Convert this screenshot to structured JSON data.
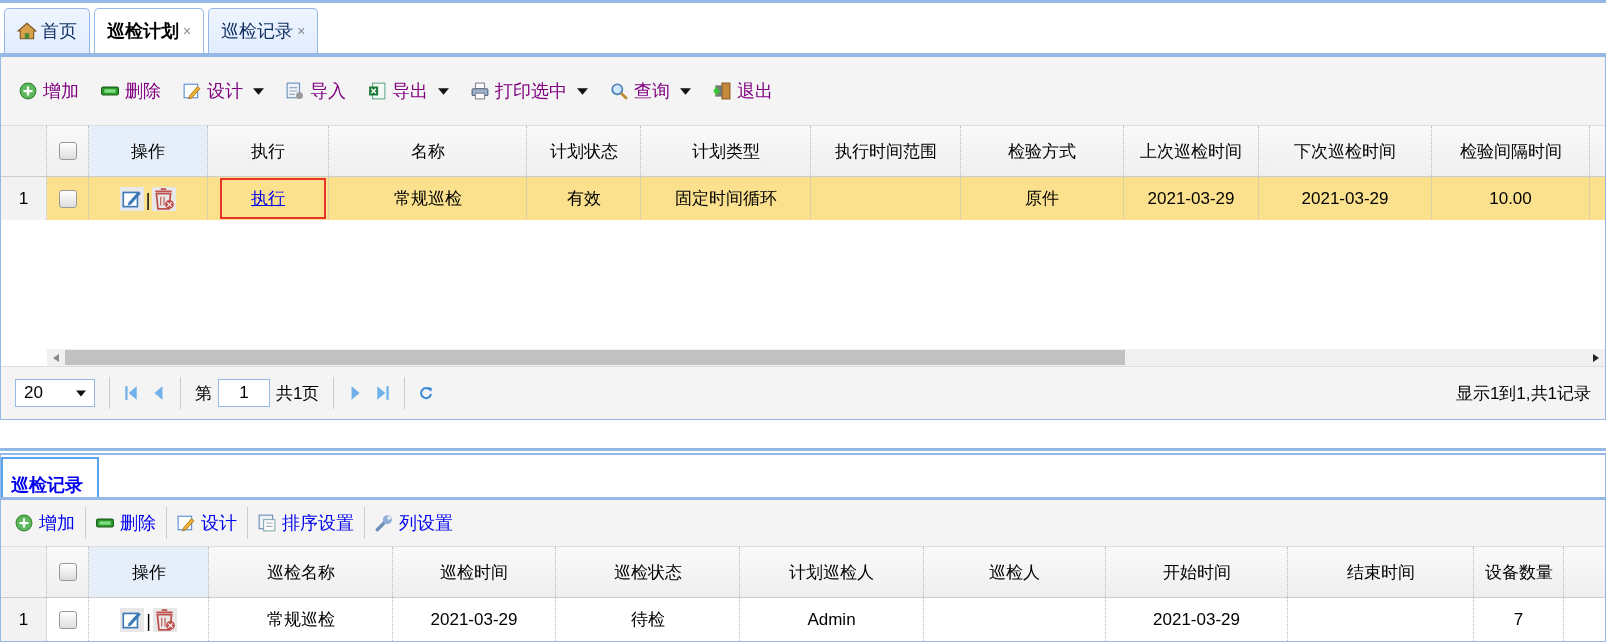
{
  "tabs": [
    {
      "label": "首页",
      "closable": false,
      "selected": false
    },
    {
      "label": "巡检计划",
      "closable": true,
      "selected": true
    },
    {
      "label": "巡检记录",
      "closable": true,
      "selected": false
    }
  ],
  "close_glyph": "×",
  "action_separator": "|",
  "plan_panel": {
    "toolbar": [
      {
        "kind": "add",
        "label": "增加",
        "dropdown": false
      },
      {
        "kind": "delete",
        "label": "删除",
        "dropdown": false
      },
      {
        "kind": "design",
        "label": "设计",
        "dropdown": true
      },
      {
        "kind": "import",
        "label": "导入",
        "dropdown": false
      },
      {
        "kind": "export",
        "label": "导出",
        "dropdown": true
      },
      {
        "kind": "print",
        "label": "打印选中",
        "dropdown": true
      },
      {
        "kind": "search",
        "label": "查询",
        "dropdown": true
      },
      {
        "kind": "exit",
        "label": "退出",
        "dropdown": false
      }
    ],
    "table": {
      "all_checked": false,
      "columns": [
        "操作",
        "执行",
        "名称",
        "计划状态",
        "计划类型",
        "执行时间范围",
        "检验方式",
        "上次巡检时间",
        "下次巡检时间",
        "检验间隔时间"
      ],
      "rows": [
        {
          "number": "1",
          "checked": false,
          "selected": true,
          "cells": [
            {
              "kind": "actions"
            },
            {
              "kind": "link",
              "text": "执行",
              "marked": true
            },
            {
              "kind": "text",
              "text": "常规巡检"
            },
            {
              "kind": "text",
              "text": "有效"
            },
            {
              "kind": "text",
              "text": "固定时间循环"
            },
            {
              "kind": "blank"
            },
            {
              "kind": "text",
              "text": "原件"
            },
            {
              "kind": "text",
              "text": "2021-03-29"
            },
            {
              "kind": "text",
              "text": "2021-03-29"
            },
            {
              "kind": "text",
              "text": "10.00"
            }
          ]
        }
      ]
    },
    "pager": {
      "page_size": "20",
      "page_label": "第",
      "page": "1",
      "page_total": "共1页",
      "summary": "显示1到1,共1记录"
    }
  },
  "record_panel": {
    "tab": {
      "label": "巡检记录",
      "selected": true
    },
    "toolbar": [
      {
        "kind": "add",
        "label": "增加",
        "dropdown": false
      },
      {
        "kind": "delete",
        "label": "删除",
        "dropdown": false
      },
      {
        "kind": "design",
        "label": "设计",
        "dropdown": false
      },
      {
        "kind": "sort",
        "label": "排序设置",
        "dropdown": false
      },
      {
        "kind": "columns",
        "label": "列设置",
        "dropdown": false
      }
    ],
    "table": {
      "all_checked": false,
      "columns": [
        "操作",
        "巡检名称",
        "巡检时间",
        "巡检状态",
        "计划巡检人",
        "巡检人",
        "开始时间",
        "结束时间",
        "设备数量"
      ],
      "rows": [
        {
          "number": "1",
          "checked": false,
          "selected": false,
          "cells": [
            {
              "kind": "actions"
            },
            {
              "kind": "text",
              "text": "常规巡检"
            },
            {
              "kind": "text",
              "text": "2021-03-29"
            },
            {
              "kind": "text",
              "text": "待检"
            },
            {
              "kind": "text",
              "text": "Admin"
            },
            {
              "kind": "blank"
            },
            {
              "kind": "text",
              "text": "2021-03-29"
            },
            {
              "kind": "blank"
            },
            {
              "kind": "text",
              "text": "7"
            }
          ]
        }
      ]
    }
  }
}
